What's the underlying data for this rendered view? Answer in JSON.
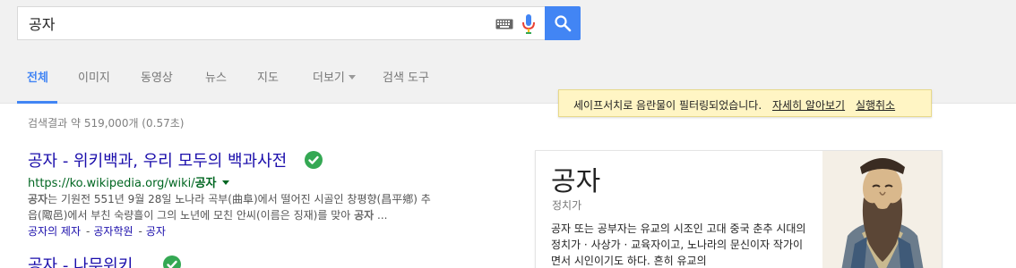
{
  "search": {
    "query": "공자",
    "keyboard_icon": "keyboard-icon",
    "mic_icon": "microphone-icon",
    "search_icon": "search-icon",
    "accent": "#4285f4"
  },
  "tabs": [
    {
      "label": "전체",
      "active": true
    },
    {
      "label": "이미지"
    },
    {
      "label": "동영상"
    },
    {
      "label": "뉴스"
    },
    {
      "label": "지도"
    },
    {
      "label": "더보기"
    },
    {
      "label": "검색 도구"
    }
  ],
  "safesearch": {
    "message": "세이프서치로 음란물이 필터링되었습니다.",
    "learn_more": "자세히 알아보기",
    "undo": "실행취소"
  },
  "result_stats": "검색결과 약 519,000개 (0.57초)",
  "results": [
    {
      "title": "공자 - 위키백과, 우리 모두의 백과사전",
      "url_prefix": "https://ko.wikipedia.org/wiki/",
      "url_bold": "공자",
      "snippet_line1_bold": "공자",
      "snippet_line1": "는 기원전 551년 9월 28일 노나라 곡부(曲阜)에서 떨어진 시골인 창평향(昌平鄕) 추",
      "snippet_line2": "읍(陬邑)에서 부친 숙량흘이 그의 노년에 모친 안씨(이름은 징재)를 맞아",
      "snippet_line2_bold": "공자",
      "snippet_line2_end": "...",
      "sitelinks": [
        "공자의 제자",
        "공자학원",
        "공자"
      ],
      "verified_icon": "verified-check-icon"
    },
    {
      "title": "공자 - 나무위키",
      "verified_icon": "verified-check-icon"
    }
  ],
  "knowledge_panel": {
    "title": "공자",
    "subtitle": "정치가",
    "description": "공자 또는 공부자는 유교의 시조인 고대 중국 춘추 시대의 정치가 · 사상가 · 교육자이고, 노나라의 문신이자 작가이면서 시인이기도 하다. 흔히 유교의",
    "portrait": "confucius-portrait"
  },
  "colors": {
    "link": "#1a0dab",
    "url_green": "#006621",
    "check_green": "#34a853"
  }
}
